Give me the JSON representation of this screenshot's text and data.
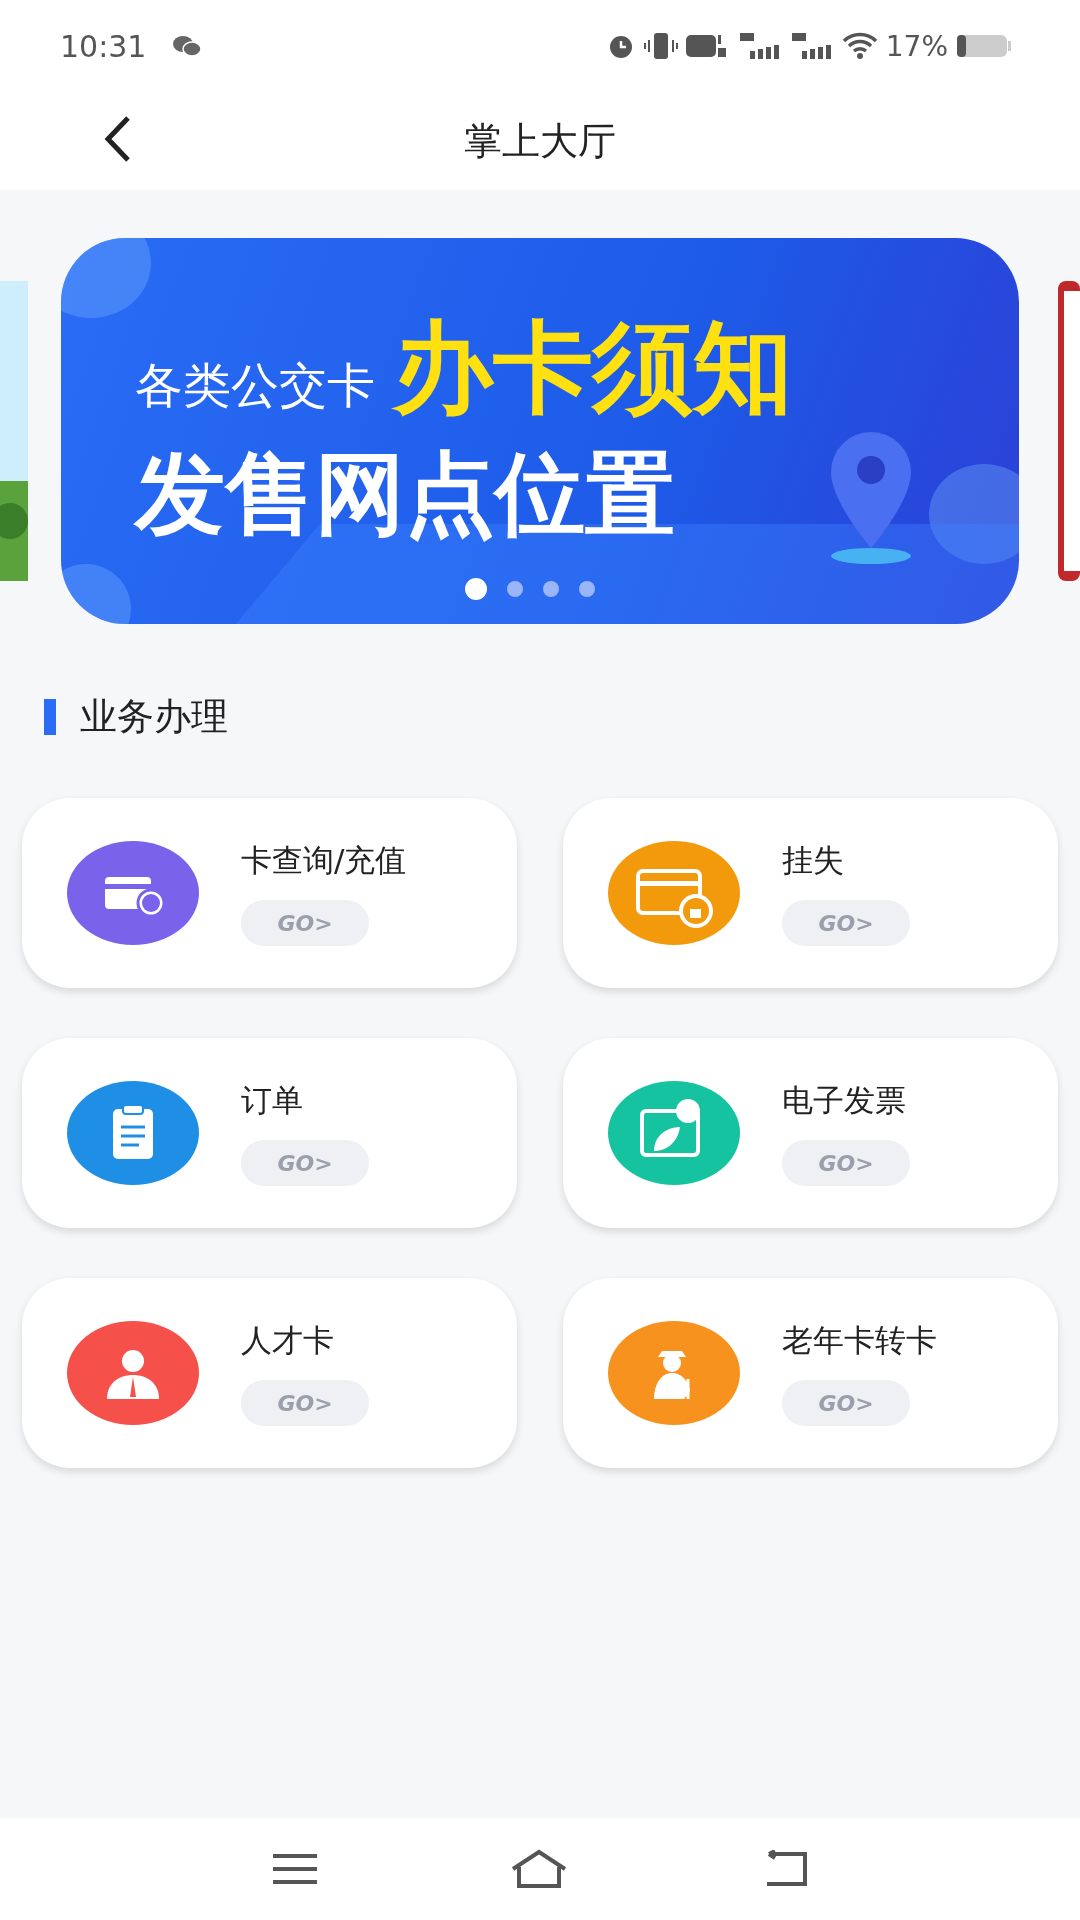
{
  "status_bar": {
    "time": "10:31",
    "battery": "17%"
  },
  "header": {
    "title": "掌上大厅"
  },
  "banner": {
    "subtitle": "各类公交卡",
    "highlight": "办卡须知",
    "headline": "发售网点位置",
    "dots": [
      {
        "selected": true
      },
      {
        "selected": false
      },
      {
        "selected": false
      },
      {
        "selected": false
      }
    ]
  },
  "section": {
    "title": "业务办理"
  },
  "services": [
    {
      "title": "卡查询/充值",
      "button": "GO>",
      "kind": "card-yen",
      "color": "#7a63ea"
    },
    {
      "title": "挂失",
      "button": "GO>",
      "kind": "card-lock",
      "color": "#f29a0c"
    },
    {
      "title": "订单",
      "button": "GO>",
      "kind": "clipboard",
      "color": "#1f8fe6"
    },
    {
      "title": "电子发票",
      "button": "GO>",
      "kind": "invoice",
      "color": "#16c3a0"
    },
    {
      "title": "人才卡",
      "button": "GO>",
      "kind": "person",
      "color": "#f5504a"
    },
    {
      "title": "老年卡转卡",
      "button": "GO>",
      "kind": "elder",
      "color": "#f7921e"
    }
  ]
}
